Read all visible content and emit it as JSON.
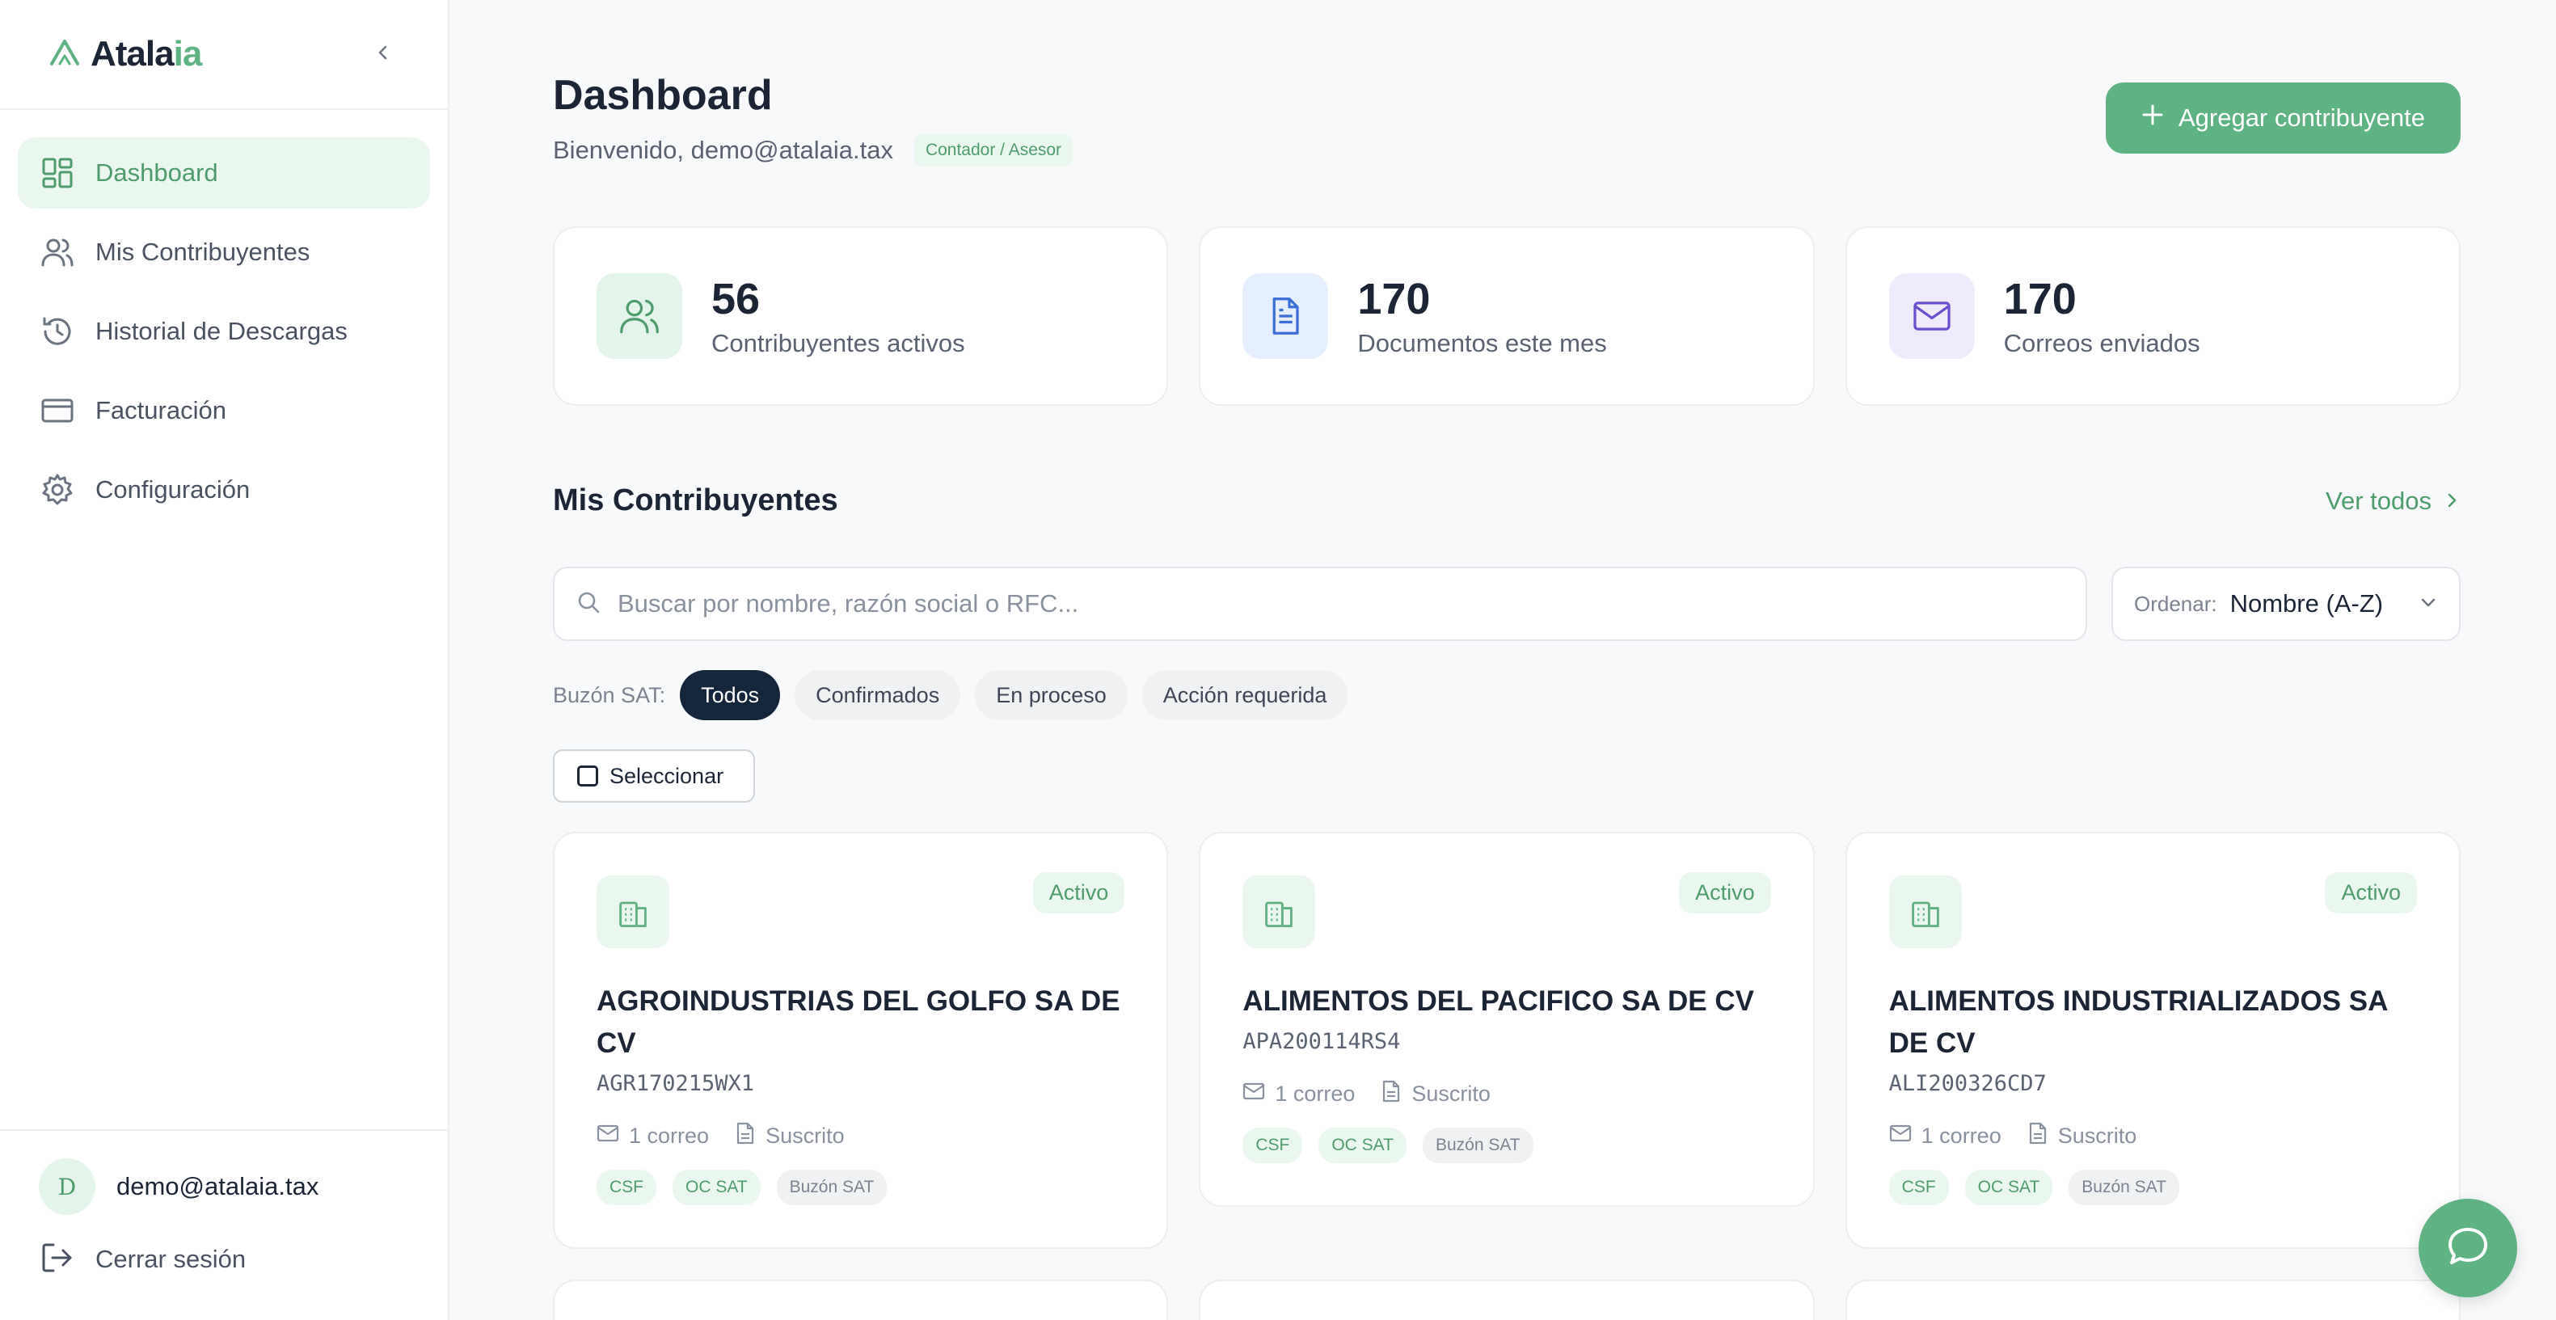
{
  "brand": {
    "name_main": "Atala",
    "name_accent": "ia"
  },
  "sidebar": {
    "items": [
      {
        "label": "Dashboard",
        "icon": "dashboard-grid-icon",
        "active": true
      },
      {
        "label": "Mis Contribuyentes",
        "icon": "users-icon"
      },
      {
        "label": "Historial de Descargas",
        "icon": "history-icon"
      },
      {
        "label": "Facturación",
        "icon": "credit-card-icon"
      },
      {
        "label": "Configuración",
        "icon": "gear-icon"
      }
    ],
    "user": {
      "initial": "D",
      "email": "demo@atalaia.tax"
    },
    "logout_label": "Cerrar sesión"
  },
  "header": {
    "title": "Dashboard",
    "welcome": "Bienvenido, demo@atalaia.tax",
    "role": "Contador / Asesor",
    "add_button": "Agregar contribuyente"
  },
  "stats": [
    {
      "value": "56",
      "label": "Contribuyentes activos",
      "icon": "users-icon",
      "color": "#4d9d6c"
    },
    {
      "value": "170",
      "label": "Documentos este mes",
      "icon": "document-icon",
      "color": "#3a6fd8"
    },
    {
      "value": "170",
      "label": "Correos enviados",
      "icon": "mail-icon",
      "color": "#6a4fd0"
    }
  ],
  "section": {
    "title": "Mis Contribuyentes",
    "view_all": "Ver todos"
  },
  "search": {
    "placeholder": "Buscar por nombre, razón social o RFC...",
    "value": ""
  },
  "sort": {
    "label": "Ordenar:",
    "value": "Nombre (A-Z)"
  },
  "filters": {
    "label": "Buzón SAT:",
    "options": [
      "Todos",
      "Confirmados",
      "En proceso",
      "Acción requerida"
    ],
    "active": "Todos"
  },
  "select_label": "Seleccionar",
  "contribuyentes": [
    {
      "name": "AGROINDUSTRIAS DEL GOLFO SA DE CV",
      "rfc": "AGR170215WX1",
      "status": "Activo",
      "emails": "1 correo",
      "subscription": "Suscrito",
      "tags": [
        "CSF",
        "OC SAT",
        "Buzón SAT"
      ]
    },
    {
      "name": "ALIMENTOS DEL PACIFICO SA DE CV",
      "rfc": "APA200114RS4",
      "status": "Activo",
      "emails": "1 correo",
      "subscription": "Suscrito",
      "tags": [
        "CSF",
        "OC SAT",
        "Buzón SAT"
      ]
    },
    {
      "name": "ALIMENTOS INDUSTRIALIZADOS SA DE CV",
      "rfc": "ALI200326CD7",
      "status": "Activo",
      "emails": "1 correo",
      "subscription": "Suscrito",
      "tags": [
        "CSF",
        "OC SAT",
        "Buzón SAT"
      ]
    }
  ],
  "colors": {
    "accent": "#5fb382",
    "accent_dark": "#4d9d6c",
    "chip_active": "#14263b"
  }
}
